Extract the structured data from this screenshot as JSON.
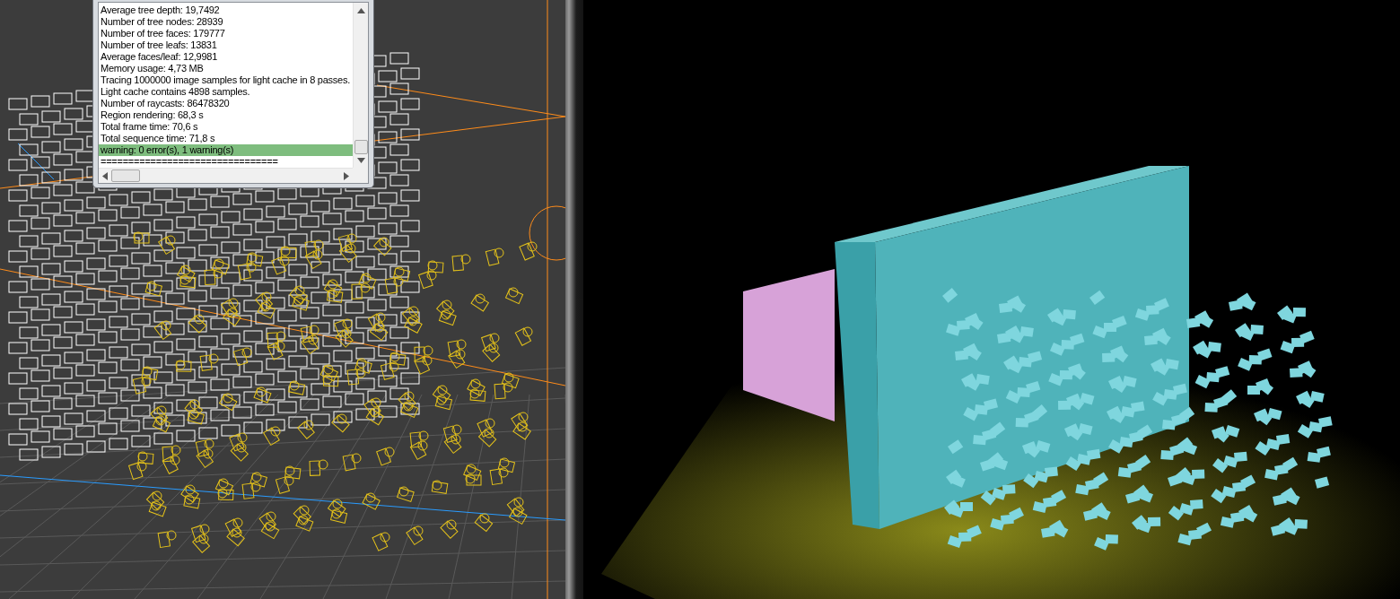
{
  "log_window": {
    "lines": [
      {
        "text": "Average tree depth: 19,7492",
        "selected": false
      },
      {
        "text": "Number of tree nodes: 28939",
        "selected": false
      },
      {
        "text": "Number of tree faces: 179777",
        "selected": false
      },
      {
        "text": "Number of tree leafs: 13831",
        "selected": false
      },
      {
        "text": "Average faces/leaf: 12,9981",
        "selected": false
      },
      {
        "text": "Memory usage: 4,73 MB",
        "selected": false
      },
      {
        "text": "Tracing 1000000 image samples for light cache in 8 passes.",
        "selected": false
      },
      {
        "text": "Light cache contains 4898 samples.",
        "selected": false
      },
      {
        "text": "Number of raycasts: 86478320",
        "selected": false
      },
      {
        "text": "Region rendering: 68,3 s",
        "selected": false
      },
      {
        "text": "Total frame time: 70,6 s",
        "selected": false
      },
      {
        "text": "Total sequence time: 71,8 s",
        "selected": false
      },
      {
        "text": "warning: 0 error(s), 1 warning(s)",
        "selected": true
      },
      {
        "text": "================================",
        "selected": false
      }
    ]
  }
}
